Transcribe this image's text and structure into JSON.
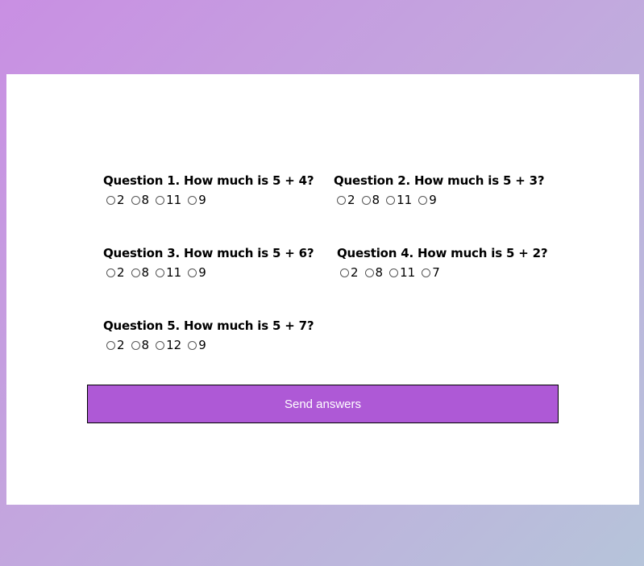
{
  "questions": [
    {
      "title": "Question 1. How much is 5 + 4?",
      "options": [
        "2",
        "8",
        "11",
        "9"
      ]
    },
    {
      "title": "Question 2. How much is 5 + 3?",
      "options": [
        "2",
        "8",
        "11",
        "9"
      ]
    },
    {
      "title": "Question 3. How much is 5 + 6?",
      "options": [
        "2",
        "8",
        "11",
        "9"
      ]
    },
    {
      "title": "Question 4. How much is 5 + 2?",
      "options": [
        "2",
        "8",
        "11",
        "7"
      ]
    },
    {
      "title": "Question 5. How much is 5 + 7?",
      "options": [
        "2",
        "8",
        "12",
        "9"
      ]
    }
  ],
  "submit": {
    "label": "Send answers"
  },
  "colors": {
    "button": "#ae59d6",
    "background_start": "#c98fe3",
    "background_end": "#b6c4da"
  }
}
